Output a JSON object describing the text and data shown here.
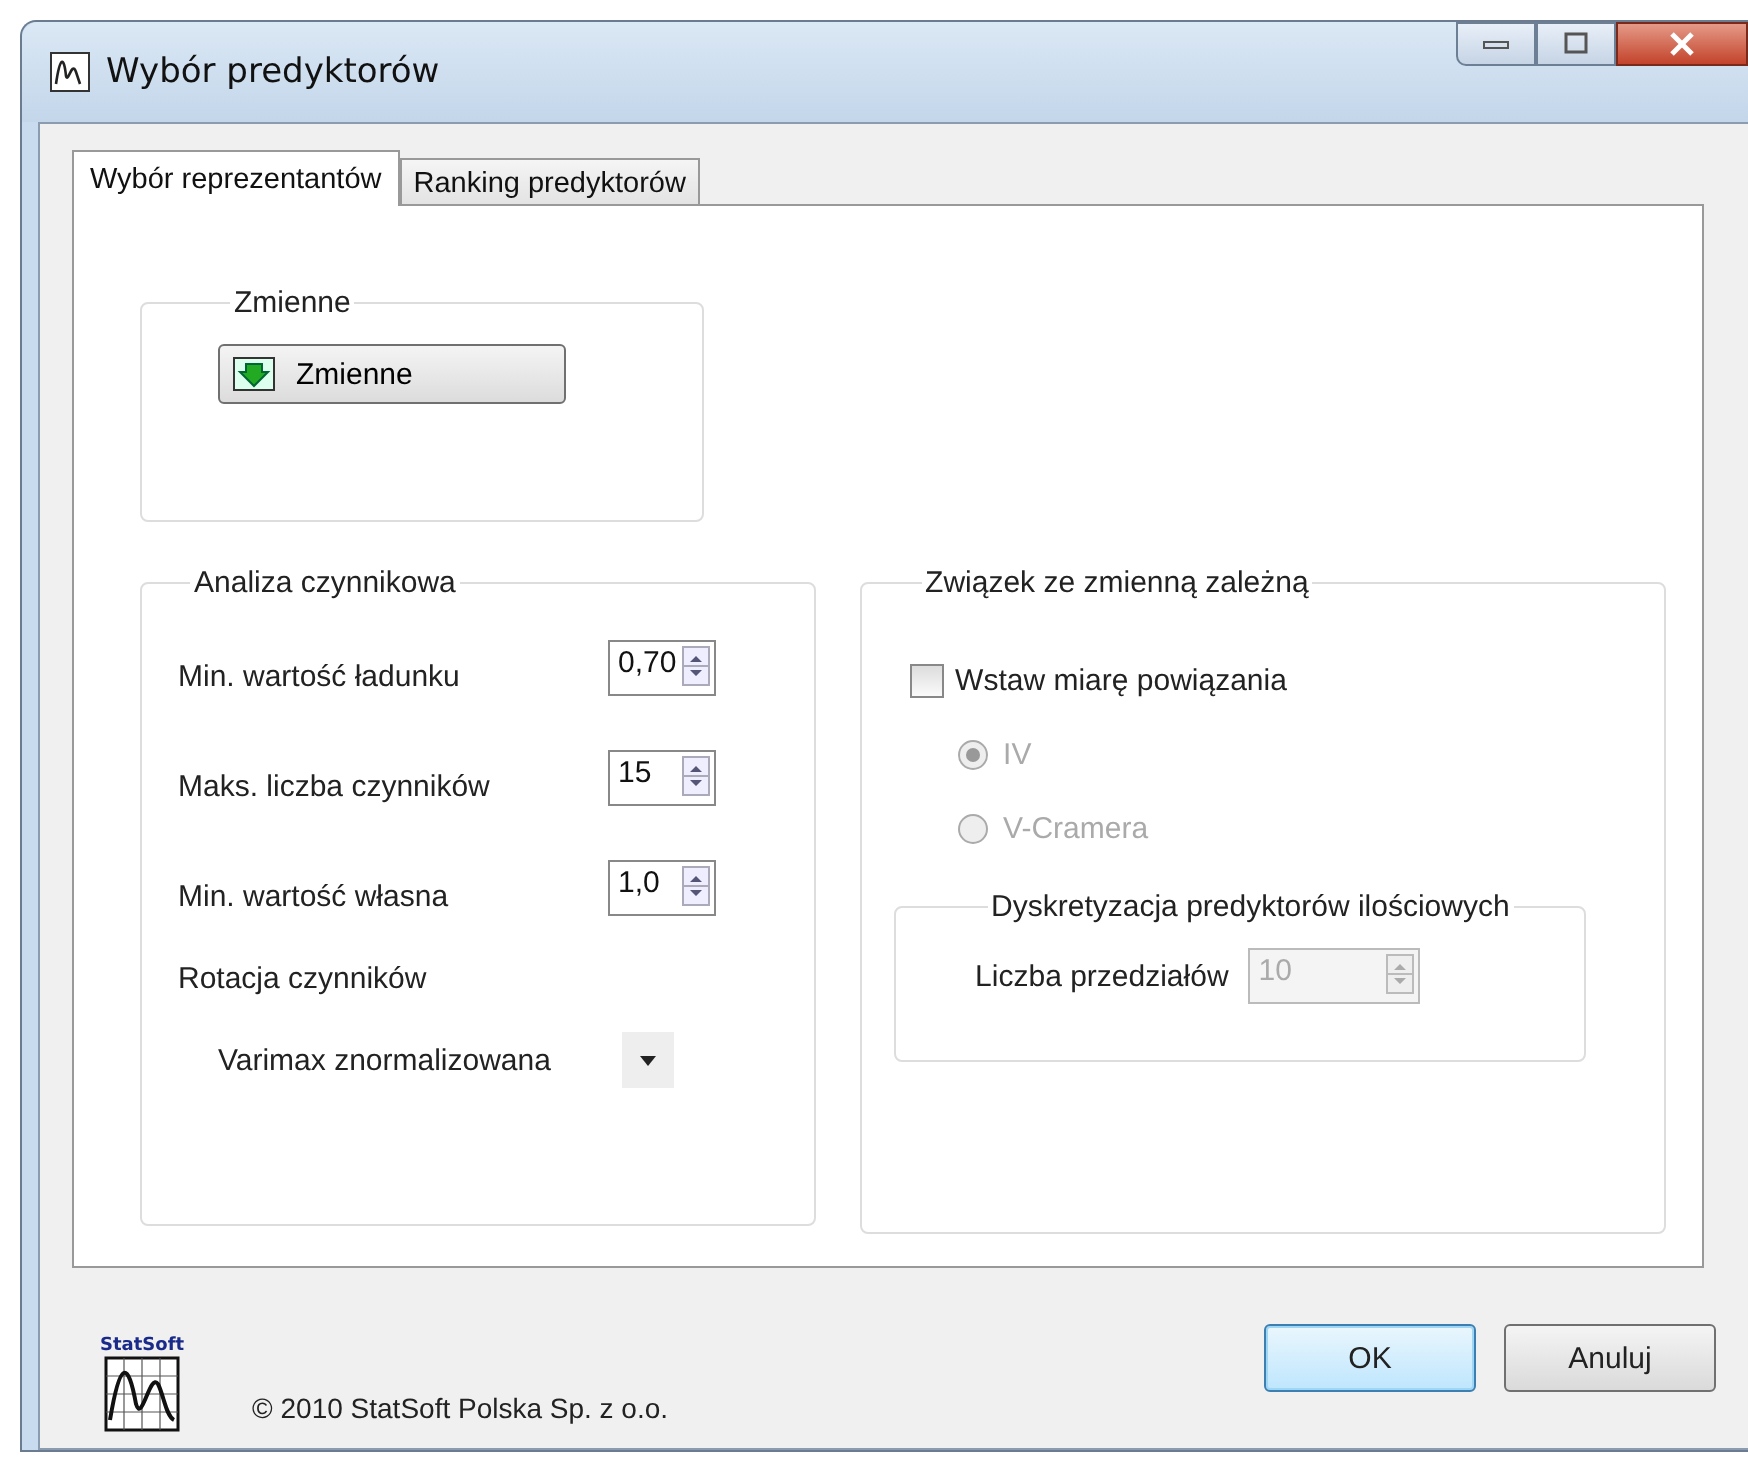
{
  "window": {
    "title": "Wybór predyktorów"
  },
  "tabs": [
    {
      "label": "Wybór reprezentantów",
      "selected": true
    },
    {
      "label": "Ranking predyktorów",
      "selected": false
    }
  ],
  "variables_group": {
    "title": "Zmienne",
    "button": "Zmienne"
  },
  "factor_group": {
    "title": "Analiza czynnikowa",
    "spinners": [
      {
        "label": "Min. wartość ładunku",
        "value": "0,70"
      },
      {
        "label": "Maks. liczba czynników",
        "value": "15"
      },
      {
        "label": "Min. wartość własna",
        "value": "1,0"
      }
    ],
    "rotation_label": "Rotacja czynników",
    "rotation_value": "Varimax znormalizowana"
  },
  "dependent_group": {
    "title": "Związek ze zmienną zależną",
    "checkbox": {
      "label": "Wstaw miarę powiązania",
      "checked": false
    },
    "radios": [
      {
        "label": "IV",
        "selected": true,
        "disabled": true
      },
      {
        "label": "V-Cramera",
        "selected": false,
        "disabled": true
      }
    ],
    "discretization": {
      "title": "Dyskretyzacja predyktorów ilościowych",
      "label": "Liczba przedziałów",
      "value": "10",
      "disabled": true
    }
  },
  "footer": {
    "logo_text": "StatSoft",
    "copyright": "© 2010 StatSoft Polska Sp. z o.o.",
    "buttons": [
      {
        "label": "OK",
        "kind": "default"
      },
      {
        "label": "Anuluj",
        "kind": "normal"
      }
    ]
  }
}
